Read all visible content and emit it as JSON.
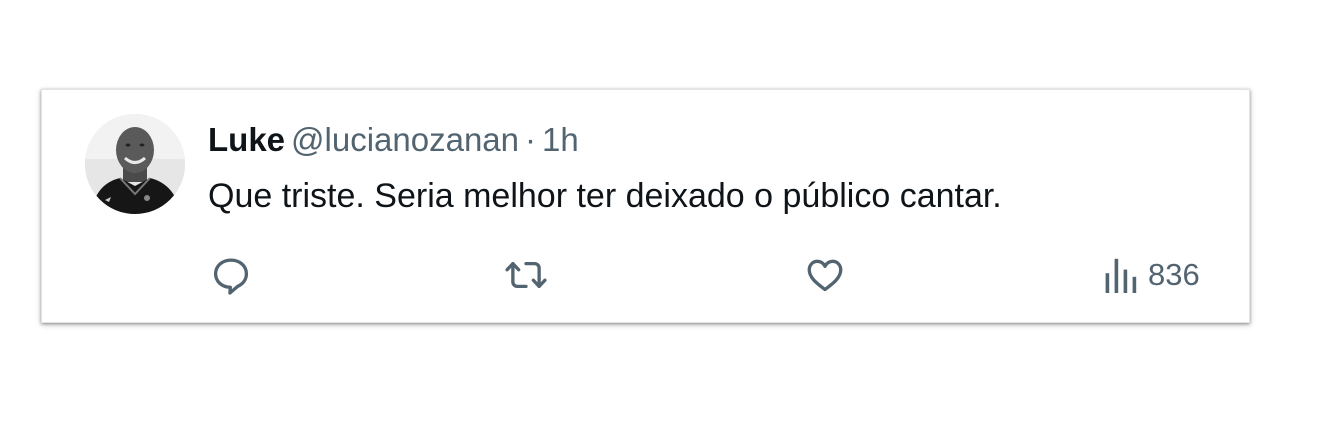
{
  "tweet": {
    "author_name": "Luke",
    "handle": "@lucianozanan",
    "separator": "·",
    "time": "1h",
    "text": "Que triste. Seria melhor ter deixado o público cantar."
  },
  "actions": {
    "reply_icon": "reply-icon",
    "retweet_icon": "retweet-icon",
    "like_icon": "heart-icon",
    "views_icon": "views-icon",
    "views_count": "836"
  },
  "colors": {
    "primary_text": "#0f1419",
    "secondary_text": "#536471",
    "background": "#ffffff"
  }
}
